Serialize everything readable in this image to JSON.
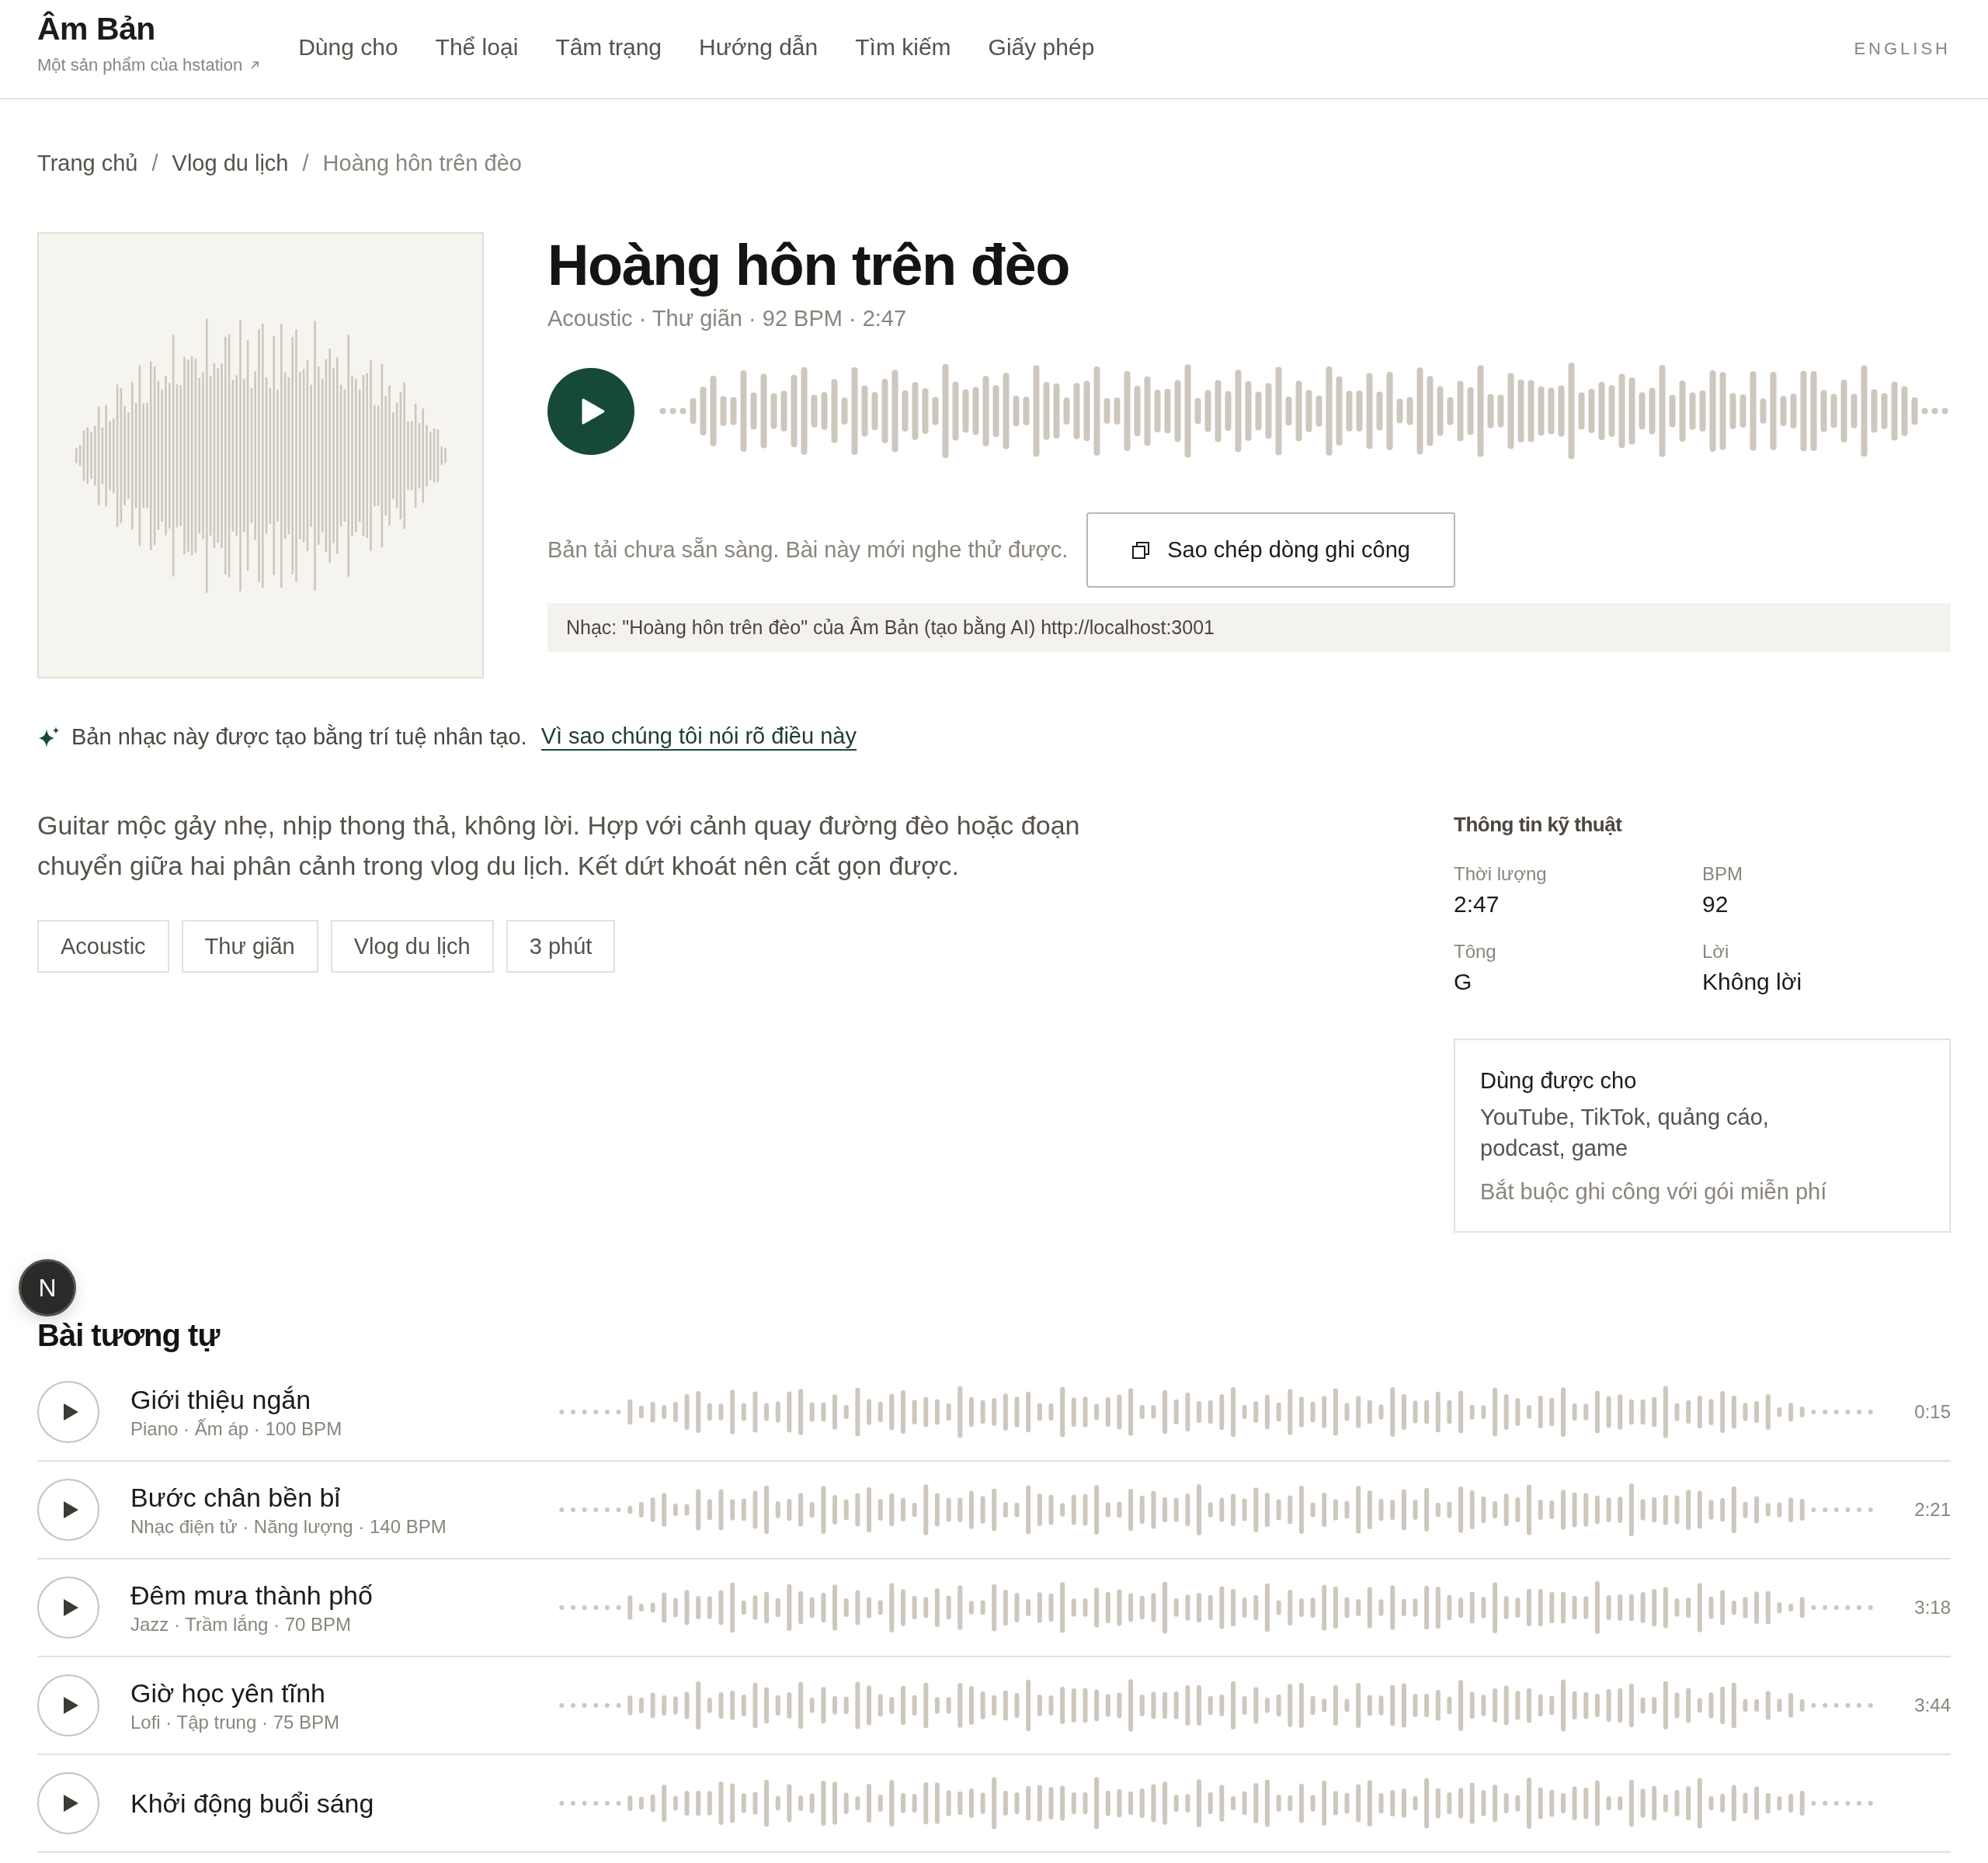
{
  "header": {
    "logo": "Âm Bản",
    "byline": "Một sản phẩm của hstation",
    "nav": [
      {
        "label": "Dùng cho"
      },
      {
        "label": "Thể loại"
      },
      {
        "label": "Tâm trạng"
      },
      {
        "label": "Hướng dẫn"
      },
      {
        "label": "Tìm kiếm"
      },
      {
        "label": "Giấy phép"
      }
    ],
    "language": "ENGLISH"
  },
  "breadcrumb": {
    "separator": "/",
    "items": [
      {
        "label": "Trang chủ",
        "current": false
      },
      {
        "label": "Vlog du lịch",
        "current": false
      },
      {
        "label": "Hoàng hôn trên đèo",
        "current": true
      }
    ]
  },
  "track": {
    "title": "Hoàng hôn trên đèo",
    "meta": "Acoustic · Thư giãn · 92 BPM · 2:47",
    "download_notice": "Bản tải chưa sẵn sàng. Bài này mới nghe thử được.",
    "copy_button": "Sao chép dòng ghi công",
    "attribution": "Nhạc: \"Hoàng hôn trên đèo\" của Âm Bản (tạo bằng AI) http://localhost:3001"
  },
  "ai_notice": {
    "text": "Bản nhạc này được tạo bằng trí tuệ nhân tạo.",
    "link": "Vì sao chúng tôi nói rõ điều này"
  },
  "description": "Guitar mộc gảy nhẹ, nhịp thong thả, không lời. Hợp với cảnh quay đường đèo hoặc đoạn chuyển giữa hai phân cảnh trong vlog du lịch. Kết dứt khoát nên cắt gọn được.",
  "tags": [
    "Acoustic",
    "Thư giãn",
    "Vlog du lịch",
    "3 phút"
  ],
  "tech_info": {
    "title": "Thông tin kỹ thuật",
    "fields": [
      {
        "label": "Thời lượng",
        "value": "2:47"
      },
      {
        "label": "BPM",
        "value": "92"
      },
      {
        "label": "Tông",
        "value": "G"
      },
      {
        "label": "Lời",
        "value": "Không lời"
      }
    ]
  },
  "usage": {
    "title": "Dùng được cho",
    "text": "YouTube, TikTok, quảng cáo, podcast, game",
    "note": "Bắt buộc ghi công với gói miễn phí"
  },
  "similar": {
    "title": "Bài tương tự",
    "tracks": [
      {
        "title": "Giới thiệu ngắn",
        "meta": "Piano · Ấm áp · 100 BPM",
        "duration": "0:15"
      },
      {
        "title": "Bước chân bền bỉ",
        "meta": "Nhạc điện tử · Năng lượng · 140 BPM",
        "duration": "2:21"
      },
      {
        "title": "Đêm mưa thành phố",
        "meta": "Jazz · Trầm lắng · 70 BPM",
        "duration": "3:18"
      },
      {
        "title": "Giờ học yên tĩnh",
        "meta": "Lofi · Tập trung · 75 BPM",
        "duration": "3:44"
      },
      {
        "title": "Khởi động buổi sáng"
      }
    ]
  },
  "dev_badge": "N"
}
